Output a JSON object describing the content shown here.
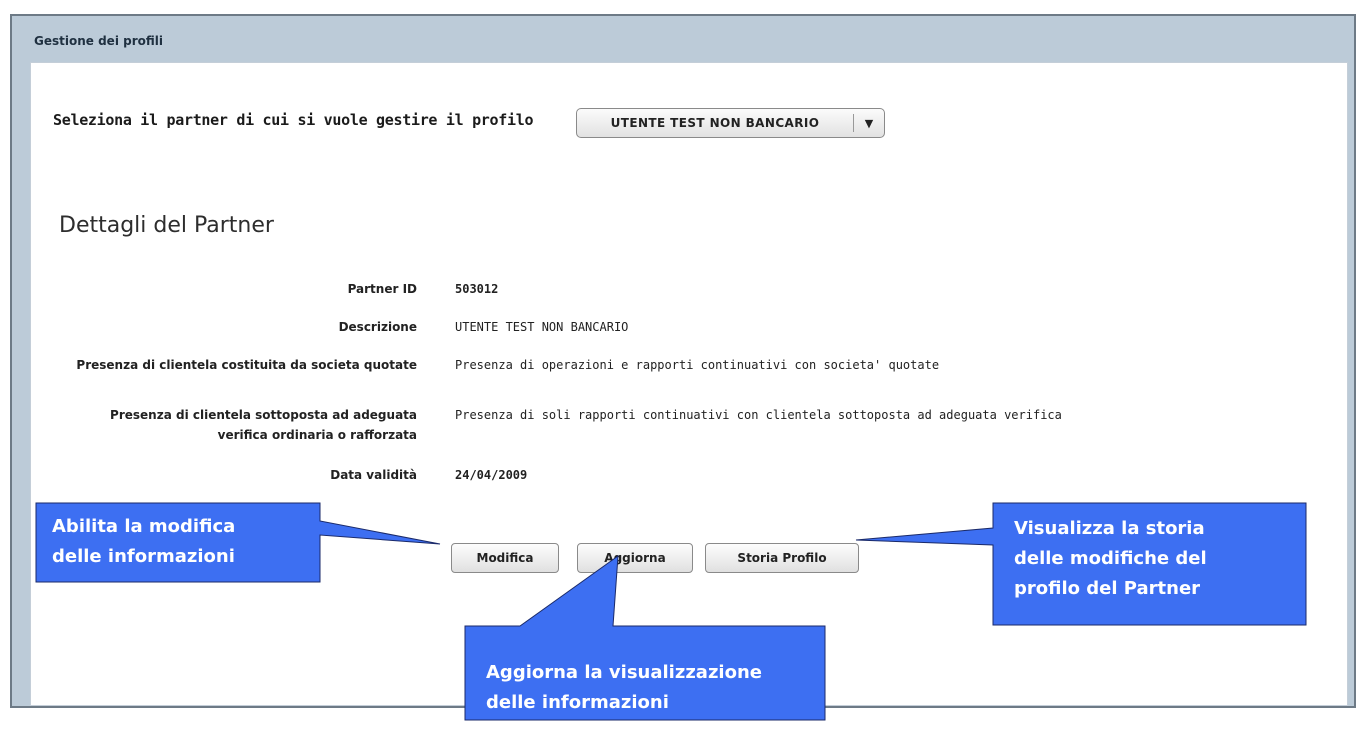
{
  "window": {
    "title": "Gestione dei profili"
  },
  "selector": {
    "label": "Seleziona il partner di cui si vuole gestire il profilo",
    "value": "UTENTE TEST NON BANCARIO",
    "arrow": "▼"
  },
  "details": {
    "title": "Dettagli del Partner",
    "rows": [
      {
        "label": "Partner ID",
        "value": "503012"
      },
      {
        "label": "Descrizione",
        "value": "UTENTE TEST NON BANCARIO"
      },
      {
        "label": "Presenza di clientela costituita da societa quotate",
        "value": "Presenza di operazioni e rapporti continuativi con societa' quotate"
      },
      {
        "label": "Presenza di clientela sottoposta ad adeguata verifica ordinaria o rafforzata",
        "value": "Presenza di soli rapporti continuativi  con clientela sottoposta ad adeguata verifica"
      },
      {
        "label": "Data validità",
        "value": "24/04/2009"
      }
    ]
  },
  "buttons": {
    "modifica": "Modifica",
    "aggiorna": "Aggiorna",
    "storia": "Storia Profilo"
  },
  "callouts": {
    "modifica": [
      "Abilita la modifica",
      "delle informazioni"
    ],
    "aggiorna": [
      "Aggiorna la visualizzazione",
      "delle informazioni"
    ],
    "storia": [
      "Visualizza la storia",
      "delle modifiche del",
      "profilo del Partner"
    ]
  },
  "colors": {
    "callout_fill": "#3d6ff2",
    "frame_bg": "#bccbd8"
  }
}
